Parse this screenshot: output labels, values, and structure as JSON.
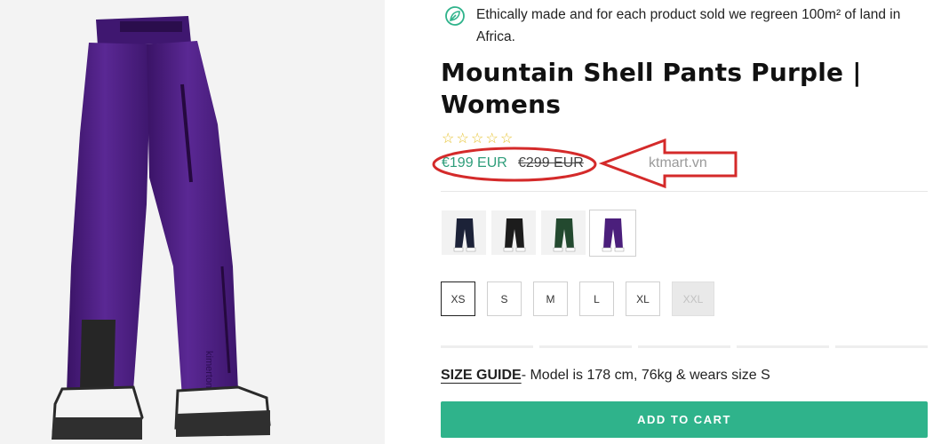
{
  "eco_notice": {
    "icon": "leaf-icon",
    "text": "Ethically made and for each product sold we regreen 100m² of land in Africa."
  },
  "product": {
    "title": "Mountain Shell Pants Purple | Womens",
    "rating_stars": 0,
    "rating_max": 5,
    "price_current": "€199 EUR",
    "price_original": "€299 EUR",
    "image_text": "kimerton"
  },
  "annotation": {
    "watermark": "ktmart.vn",
    "color": "#d42a2a"
  },
  "color_swatches": [
    {
      "name": "navy",
      "color": "#1c2238"
    },
    {
      "name": "black",
      "color": "#1c1c1c"
    },
    {
      "name": "green",
      "color": "#23492f"
    },
    {
      "name": "purple",
      "color": "#4b1f7c",
      "selected": true
    }
  ],
  "sizes": [
    {
      "label": "XS",
      "selected": true
    },
    {
      "label": "S"
    },
    {
      "label": "M"
    },
    {
      "label": "L"
    },
    {
      "label": "XL"
    },
    {
      "label": "XXL",
      "disabled": true
    }
  ],
  "size_guide": {
    "link_label": "SIZE GUIDE",
    "text": "- Model is 178 cm, 76kg & wears size S"
  },
  "cart": {
    "button_label": "ADD TO CART"
  },
  "colors": {
    "accent": "#2fb38b",
    "price": "#2e9d7a",
    "product": "#4b1f7c"
  }
}
